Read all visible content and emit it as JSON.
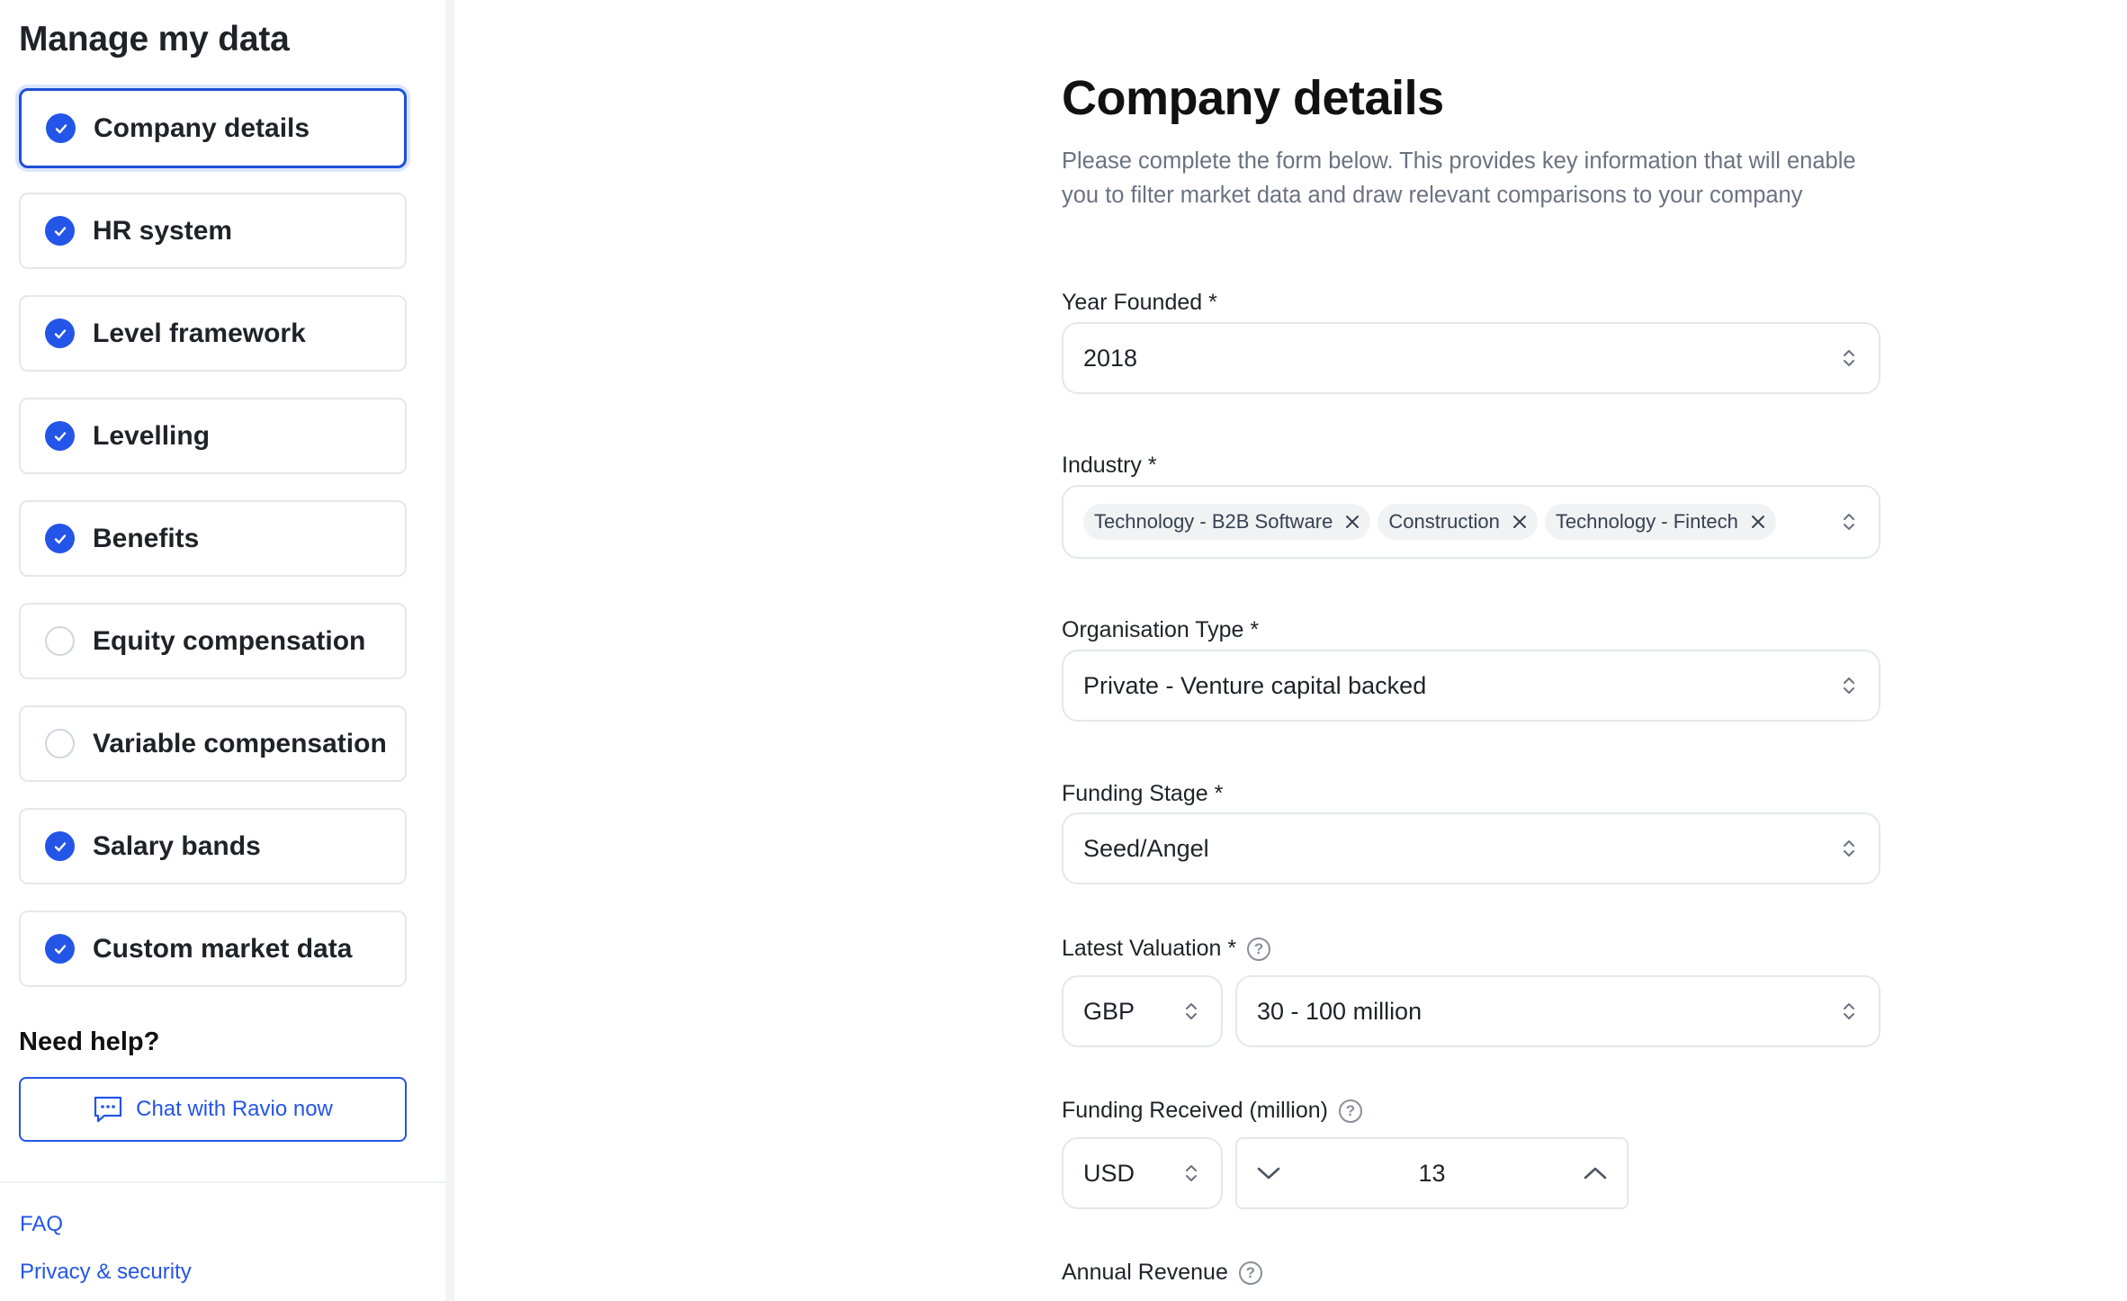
{
  "sidebar": {
    "title": "Manage my data",
    "items": [
      {
        "label": "Company details",
        "done": true,
        "active": true
      },
      {
        "label": "HR system",
        "done": true
      },
      {
        "label": "Level framework",
        "done": true
      },
      {
        "label": "Levelling",
        "done": true
      },
      {
        "label": "Benefits",
        "done": true
      },
      {
        "label": "Equity compensation",
        "done": false
      },
      {
        "label": "Variable compensation",
        "done": false
      },
      {
        "label": "Salary bands",
        "done": true
      },
      {
        "label": "Custom market data",
        "done": true
      }
    ],
    "help_title": "Need help?",
    "chat_label": "Chat with Ravio now",
    "footer": {
      "faq": "FAQ",
      "privacy": "Privacy & security"
    }
  },
  "main": {
    "title": "Company details",
    "description": "Please complete the form below. This provides key information that will enable you to filter market data and draw relevant comparisons to your company",
    "fields": {
      "year_founded": {
        "label": "Year Founded *",
        "value": "2018"
      },
      "industry": {
        "label": "Industry *",
        "chips": [
          "Technology - B2B Software",
          "Construction",
          "Technology - Fintech"
        ]
      },
      "organisation_type": {
        "label": "Organisation Type *",
        "value": "Private - Venture capital backed"
      },
      "funding_stage": {
        "label": "Funding Stage *",
        "value": "Seed/Angel"
      },
      "latest_valuation": {
        "label": "Latest Valuation *",
        "currency": "GBP",
        "value": "30 - 100 million"
      },
      "funding_received": {
        "label": "Funding Received (million)",
        "currency": "USD",
        "value": "13"
      },
      "annual_revenue": {
        "label": "Annual Revenue"
      }
    }
  },
  "colors": {
    "accent": "#2355e8",
    "border": "#e5e7eb",
    "muted": "#6b7280"
  }
}
